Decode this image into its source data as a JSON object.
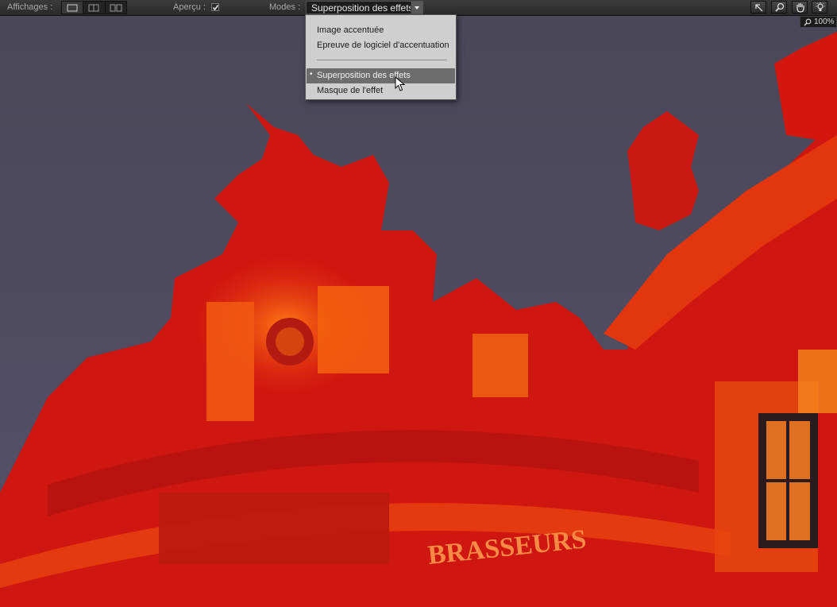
{
  "toolbar": {
    "views_label": "Affichages :",
    "preview_label": "Aperçu :",
    "preview_checked": true,
    "modes_label": "Modes :",
    "mode_value": "Superposition des effets",
    "view_buttons": [
      "single-view-icon",
      "split-vertical-icon",
      "side-by-side-icon"
    ],
    "tools": [
      "arrow-pointer-icon",
      "zoom-icon",
      "hand-icon",
      "light-bulb-icon"
    ]
  },
  "zoom": {
    "level": "100%"
  },
  "modes_menu": {
    "items": [
      {
        "label": "Image accentuée",
        "selected": false
      },
      {
        "label": "Epreuve de logiciel d'accentuation",
        "selected": false
      },
      {
        "label": "Superposition des effets",
        "selected": true
      },
      {
        "label": "Masque de l'effet",
        "selected": false
      }
    ]
  },
  "photo": {
    "sign_text": "BRASSEURS",
    "colors": {
      "sky": "#4d4a5e",
      "building": "#d2150d",
      "highlight": "#ff6a10"
    }
  }
}
